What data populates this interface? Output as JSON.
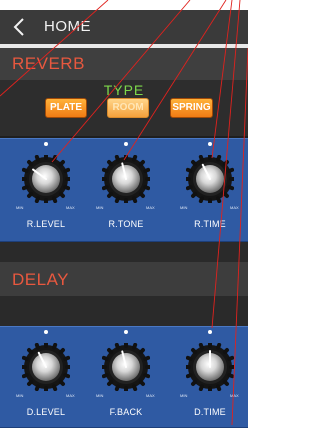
{
  "header": {
    "back_icon": "chevron-left-icon",
    "title": "HOME"
  },
  "reverb": {
    "title": "REVERB",
    "type_label": "TYPE",
    "types": [
      {
        "label": "PLATE",
        "active": false
      },
      {
        "label": "ROOM",
        "active": true
      },
      {
        "label": "SPRING",
        "active": false
      }
    ],
    "knobs": [
      {
        "label": "R.LEVEL",
        "min": "MIN",
        "max": "MAX",
        "value": 0.3
      },
      {
        "label": "R.TONE",
        "min": "MIN",
        "max": "MAX",
        "value": 0.45
      },
      {
        "label": "R.TIME",
        "min": "MIN",
        "max": "MAX",
        "value": 0.4
      }
    ]
  },
  "delay": {
    "title": "DELAY",
    "knobs": [
      {
        "label": "D.LEVEL",
        "min": "MIN",
        "max": "MAX",
        "value": 0.4
      },
      {
        "label": "F.BACK",
        "min": "MIN",
        "max": "MAX",
        "value": 0.45
      },
      {
        "label": "D.TIME",
        "min": "MIN",
        "max": "MAX",
        "value": 0.5
      }
    ]
  },
  "colors": {
    "section_title": "#e8583f",
    "type_label": "#7dd84a",
    "panel": "#2f5aa3",
    "button": "#f07b14",
    "callout_line": "#e0221e"
  }
}
